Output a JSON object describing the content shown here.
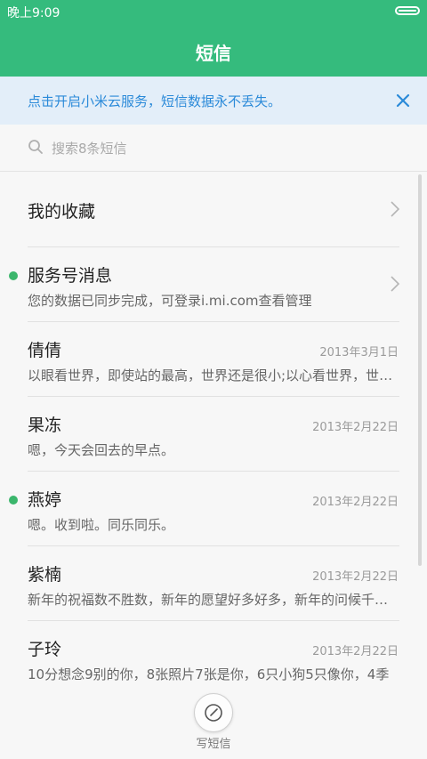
{
  "status": {
    "time": "晚上9:09",
    "battery_level": 1.0
  },
  "header": {
    "title": "短信"
  },
  "banner": {
    "text": "点击开启小米云服务，短信数据永不丢失。",
    "close_icon": "close-icon",
    "accent": "#2b8ad9"
  },
  "search": {
    "placeholder": "搜索8条短信",
    "icon": "search-icon"
  },
  "favorites": {
    "label": "我的收藏"
  },
  "conversations": [
    {
      "name": "服务号消息",
      "date": "",
      "preview": "您的数据已同步完成，可登录i.mi.com查看管理",
      "unread": true,
      "chevron": true
    },
    {
      "name": "倩倩",
      "date": "2013年3月1日",
      "preview": "以眼看世界，即使站的最高，世界还是很小;以心看世界，世界无限大",
      "unread": false,
      "chevron": false
    },
    {
      "name": "果冻",
      "date": "2013年2月22日",
      "preview": "嗯，今天会回去的早点。",
      "unread": false,
      "chevron": false
    },
    {
      "name": "燕婷",
      "date": "2013年2月22日",
      "preview": "嗯。收到啦。同乐同乐。",
      "unread": true,
      "chevron": false
    },
    {
      "name": "紫楠",
      "date": "2013年2月22日",
      "preview": "新年的祝福数不胜数，新年的愿望好多好多，新年的问候千言万语",
      "unread": false,
      "chevron": false
    },
    {
      "name": "子玲",
      "date": "2013年2月22日",
      "preview": "10分想念9别的你，8张照片7张是你，6只小狗5只像你，4季",
      "unread": false,
      "chevron": false
    }
  ],
  "compose": {
    "label": "写短信",
    "icon": "compose-icon"
  },
  "colors": {
    "header_bg": "#35bb7d",
    "unread_dot": "#3bb66c",
    "banner_bg": "#e3eef9"
  }
}
